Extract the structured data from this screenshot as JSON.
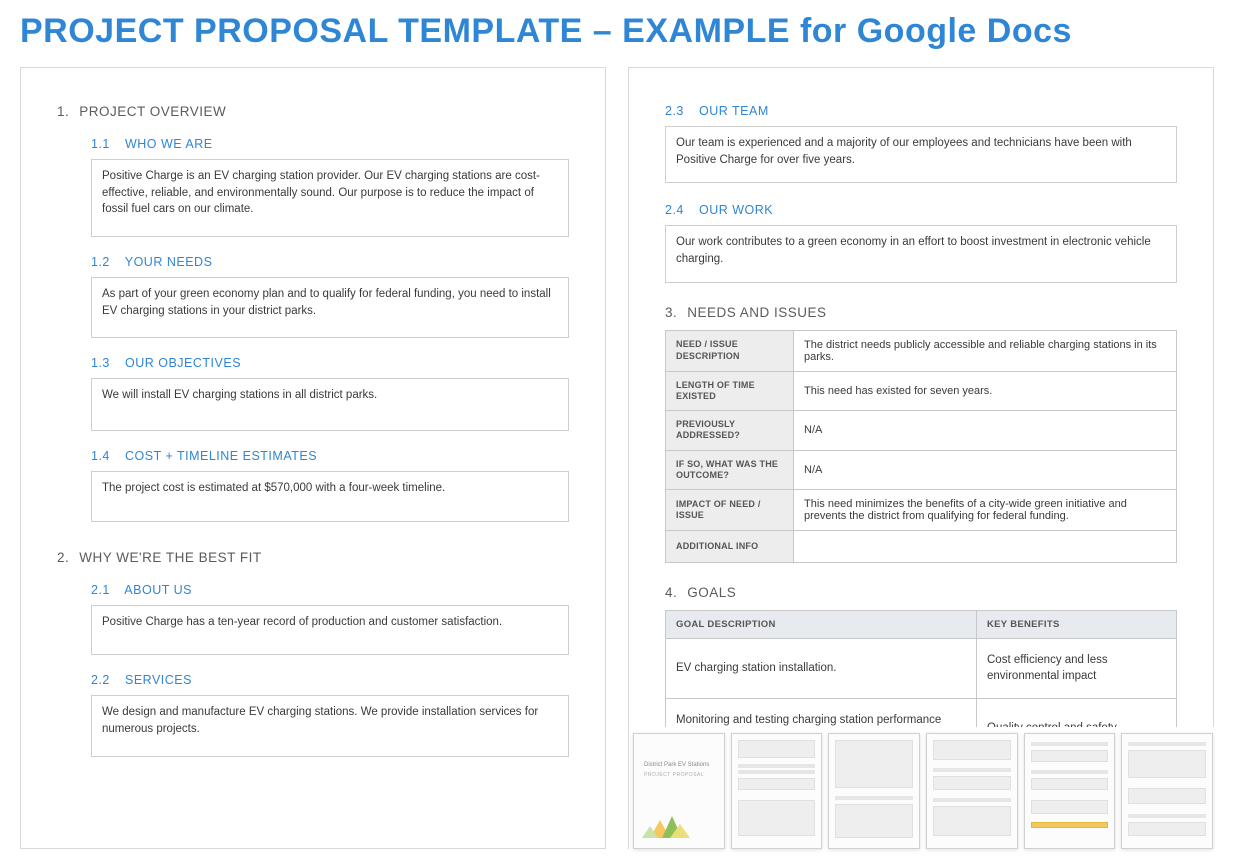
{
  "title": "PROJECT PROPOSAL TEMPLATE – EXAMPLE for Google Docs",
  "sections": {
    "overview": {
      "num": "1.",
      "title": "PROJECT OVERVIEW",
      "who_we_are": {
        "num": "1.1",
        "title": "WHO WE ARE",
        "text": "Positive Charge is an EV charging station provider. Our EV charging stations are cost-effective, reliable, and environmentally sound. Our purpose is to reduce the impact of fossil fuel cars on our climate."
      },
      "your_needs": {
        "num": "1.2",
        "title": "YOUR NEEDS",
        "text": "As part of your green economy plan and to qualify for federal funding, you need to install EV charging stations in your district parks."
      },
      "objectives": {
        "num": "1.3",
        "title": "OUR OBJECTIVES",
        "text": "We will install EV charging stations in all district parks."
      },
      "cost": {
        "num": "1.4",
        "title": "COST + TIMELINE ESTIMATES",
        "text": "The project cost is estimated at $570,000 with a four-week timeline."
      }
    },
    "bestfit": {
      "num": "2.",
      "title": "WHY WE'RE THE BEST FIT",
      "about": {
        "num": "2.1",
        "title": "ABOUT US",
        "text": "Positive Charge has a ten-year record of production and customer satisfaction."
      },
      "services": {
        "num": "2.2",
        "title": "SERVICES",
        "text": "We design and manufacture EV charging stations. We provide installation services for numerous projects."
      },
      "team": {
        "num": "2.3",
        "title": "OUR TEAM",
        "text": "Our team is experienced and a majority of our employees and technicians have been with Positive Charge for over five years."
      },
      "work": {
        "num": "2.4",
        "title": "OUR WORK",
        "text": "Our work contributes to a green economy in an effort to boost investment in electronic vehicle charging."
      }
    },
    "needs": {
      "num": "3.",
      "title": "NEEDS AND ISSUES",
      "rows": [
        {
          "label": "NEED / ISSUE DESCRIPTION",
          "value": "The district needs publicly accessible and reliable charging stations in its parks."
        },
        {
          "label": "LENGTH OF TIME EXISTED",
          "value": "This need has existed for seven years."
        },
        {
          "label": "PREVIOUSLY ADDRESSED?",
          "value": "N/A"
        },
        {
          "label": "IF SO, WHAT WAS THE OUTCOME?",
          "value": "N/A"
        },
        {
          "label": "IMPACT OF NEED / ISSUE",
          "value": "This need minimizes the benefits of a city-wide green initiative and prevents the district from qualifying for federal funding."
        },
        {
          "label": "ADDITIONAL INFO",
          "value": ""
        }
      ]
    },
    "goals": {
      "num": "4.",
      "title": "GOALS",
      "headers": {
        "a": "GOAL DESCRIPTION",
        "b": "KEY BENEFITS"
      },
      "rows": [
        {
          "a": "EV charging station installation.",
          "b": "Cost efficiency and less environmental impact"
        },
        {
          "a": "Monitoring and testing charging station performance during the project timeline.",
          "b": "Quality control and safety"
        }
      ]
    }
  },
  "thumbs": {
    "cover_title": "District Park EV Stations",
    "cover_sub": "PROJECT PROPOSAL"
  }
}
